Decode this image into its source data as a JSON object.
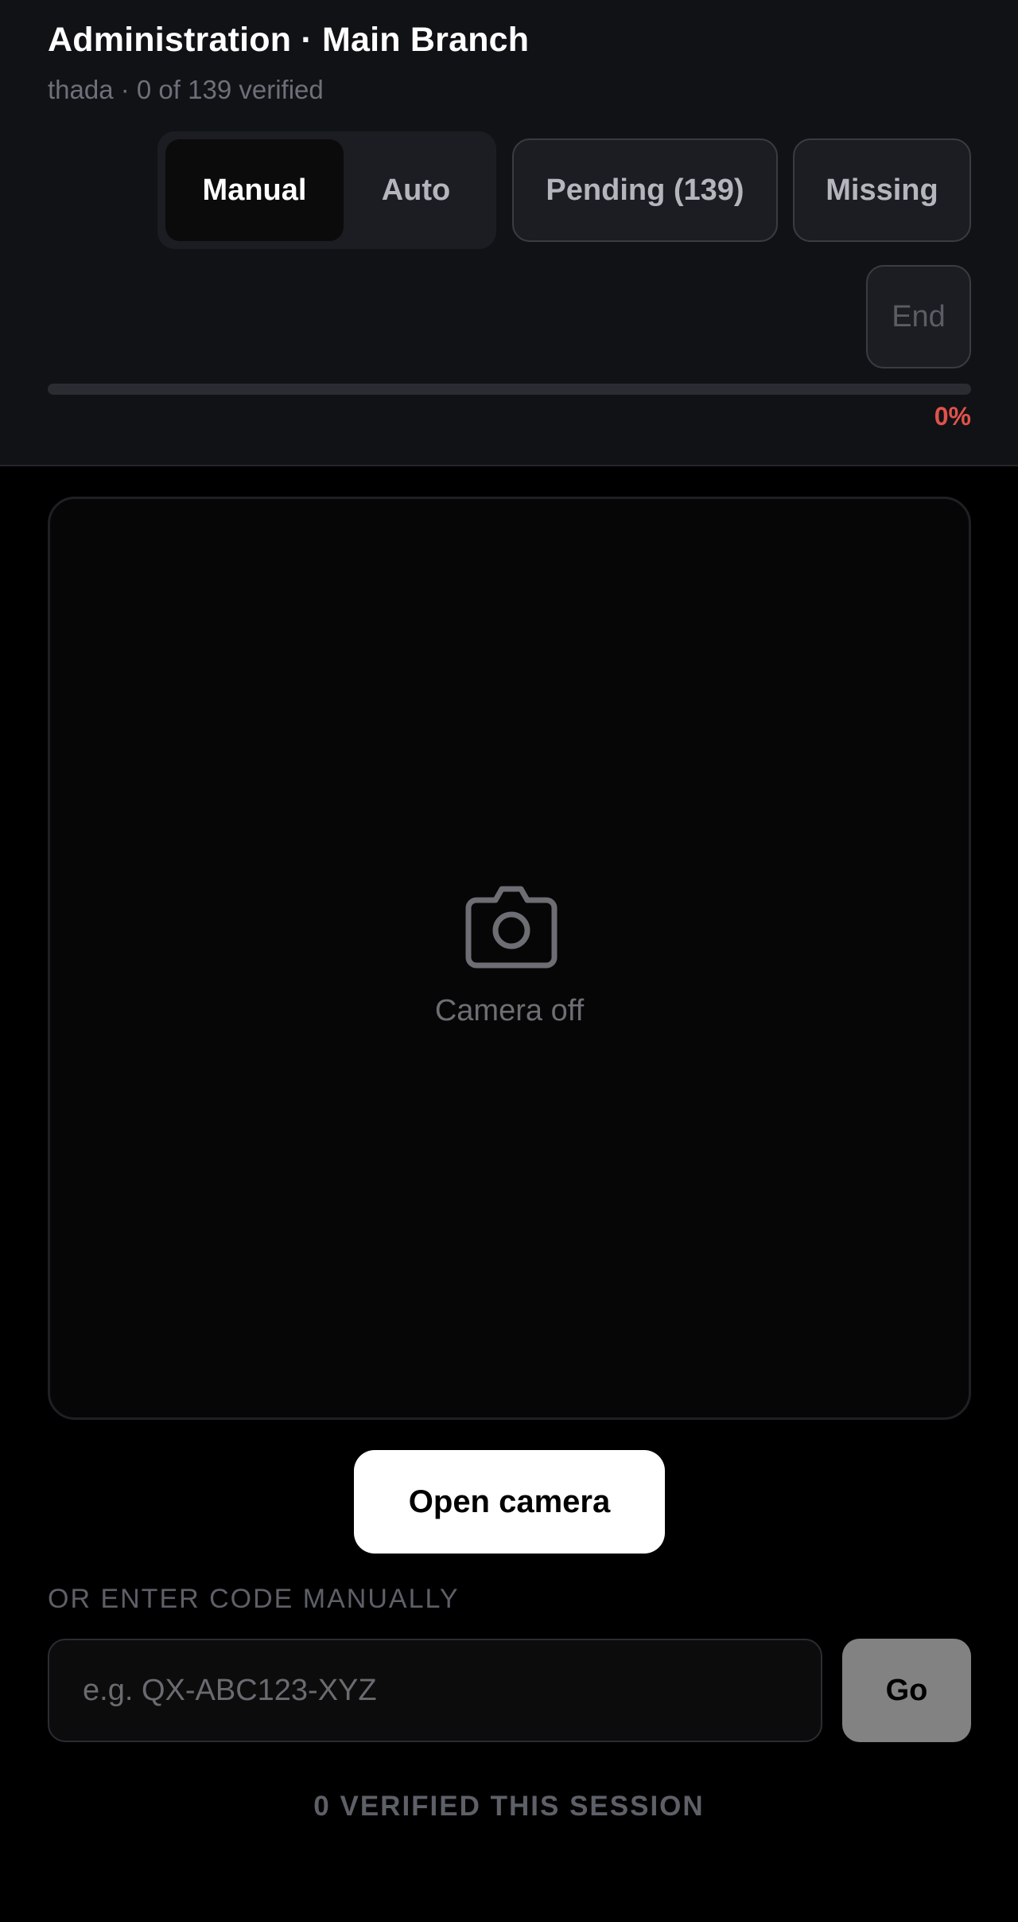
{
  "header": {
    "title": "Administration · Main Branch",
    "subtitle": "thada · 0 of 139 verified"
  },
  "mode_toggle": {
    "options": [
      {
        "label": "Manual",
        "selected": true
      },
      {
        "label": "Auto",
        "selected": false
      }
    ]
  },
  "filters": {
    "pending_label": "Pending (139)",
    "missing_label": "Missing"
  },
  "actions": {
    "end_label": "End"
  },
  "progress": {
    "percent_value": 0,
    "percent_label": "0%"
  },
  "camera": {
    "icon": "camera-icon",
    "status_text": "Camera off",
    "open_button_label": "Open camera"
  },
  "manual_entry": {
    "section_label": "OR ENTER CODE MANUALLY",
    "input_value": "",
    "input_placeholder": "e.g. QX-ABC123-XYZ",
    "submit_label": "Go"
  },
  "session": {
    "verified_text": "0 VERIFIED THIS SESSION"
  },
  "colors": {
    "header_bg": "#111216",
    "page_bg": "#000000",
    "accent_danger": "#e0534a",
    "primary_button_bg": "#ffffff",
    "go_button_bg": "#828282"
  }
}
